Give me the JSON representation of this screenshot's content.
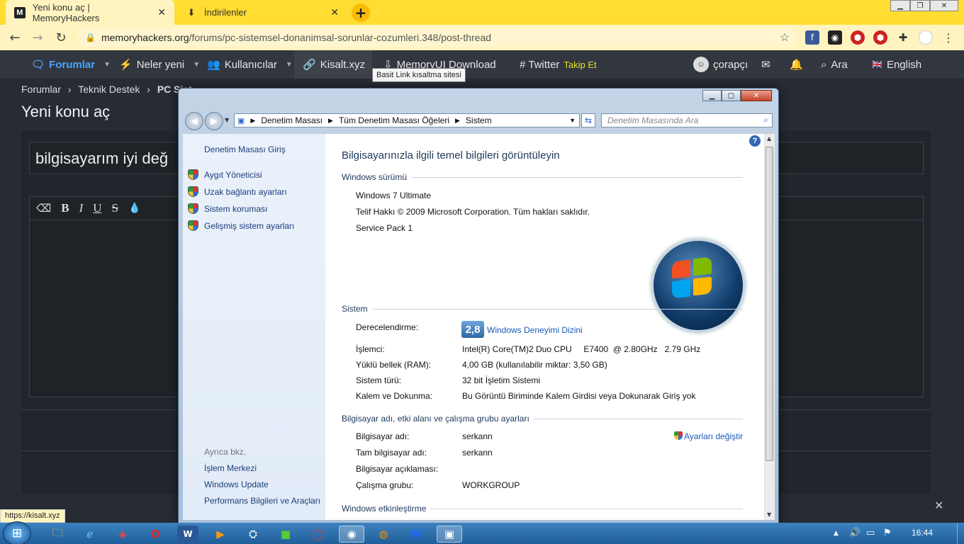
{
  "browser": {
    "tabs": [
      {
        "title": "Yeni konu aç | MemoryHackers",
        "favicon": "M"
      },
      {
        "title": "İndirilenler"
      }
    ],
    "url_host": "memoryhackers.org",
    "url_path": "/forums/pc-sistemsel-donanimsal-sorunlar-cozumleri.348/post-thread",
    "status_url": "https://kisalt.xyz"
  },
  "site": {
    "nav": {
      "forums": "Forumlar",
      "whats_new": "Neler yeni",
      "members": "Kullanıcılar",
      "shortener": "Kisalt.xyz",
      "download": "MemoryUI Download",
      "twitter": "# Twitter",
      "twitter_follow": "Takip Et",
      "user": "çorapçı",
      "search": "Ara",
      "language": "English"
    },
    "tooltip": "Basit Link kısaltma sitesi",
    "breadcrumb": [
      "Forumlar",
      "Teknik Destek",
      "PC Sist"
    ],
    "page_title": "Yeni konu aç",
    "thread_title": "bilgisayarım iyi değ"
  },
  "explorer": {
    "address": [
      "Denetim Masası",
      "Tüm Denetim Masası Öğeleri",
      "Sistem"
    ],
    "search_placeholder": "Denetim Masasında Ara",
    "left": {
      "home": "Denetim Masası Giriş",
      "tasks": [
        "Aygıt Yöneticisi",
        "Uzak bağlantı ayarları",
        "Sistem koruması",
        "Gelişmiş sistem ayarları"
      ],
      "see_also": "Ayrıca bkz.",
      "links": [
        "İşlem Merkezi",
        "Windows Update",
        "Performans Bilgileri ve Araçları"
      ]
    },
    "main": {
      "heading": "Bilgisayarınızla ilgili temel bilgileri görüntüleyin",
      "edition_section": "Windows sürümü",
      "edition": "Windows 7 Ultimate",
      "copyright": "Telif Hakkı © 2009 Microsoft Corporation. Tüm hakları saklıdır.",
      "service_pack": "Service Pack 1",
      "system_section": "Sistem",
      "rating_label": "Derecelendirme:",
      "rating_value": "2,8",
      "rating_link": "Windows Deneyimi Dizini",
      "cpu_label": "İşlemci:",
      "cpu_value": "Intel(R) Core(TM)2 Duo CPU     E7400  @ 2.80GHz   2.79 GHz",
      "ram_label": "Yüklü bellek (RAM):",
      "ram_value": "4,00 GB (kullanılabilir miktar: 3,50 GB)",
      "type_label": "Sistem türü:",
      "type_value": "32 bit İşletim Sistemi",
      "pen_label": "Kalem ve Dokunma:",
      "pen_value": "Bu Görüntü Biriminde Kalem Girdisi veya Dokunarak Giriş yok",
      "name_section": "Bilgisayar adı, etki alanı ve çalışma grubu ayarları",
      "change_settings": "Ayarları değiştir",
      "pcname_label": "Bilgisayar adı:",
      "pcname_value": "serkann",
      "fullname_label": "Tam bilgisayar adı:",
      "fullname_value": "serkann",
      "desc_label": "Bilgisayar açıklaması:",
      "workgroup_label": "Çalışma grubu:",
      "workgroup_value": "WORKGROUP",
      "activation_section": "Windows etkinleştirme"
    }
  },
  "taskbar": {
    "clock": "16:44"
  }
}
